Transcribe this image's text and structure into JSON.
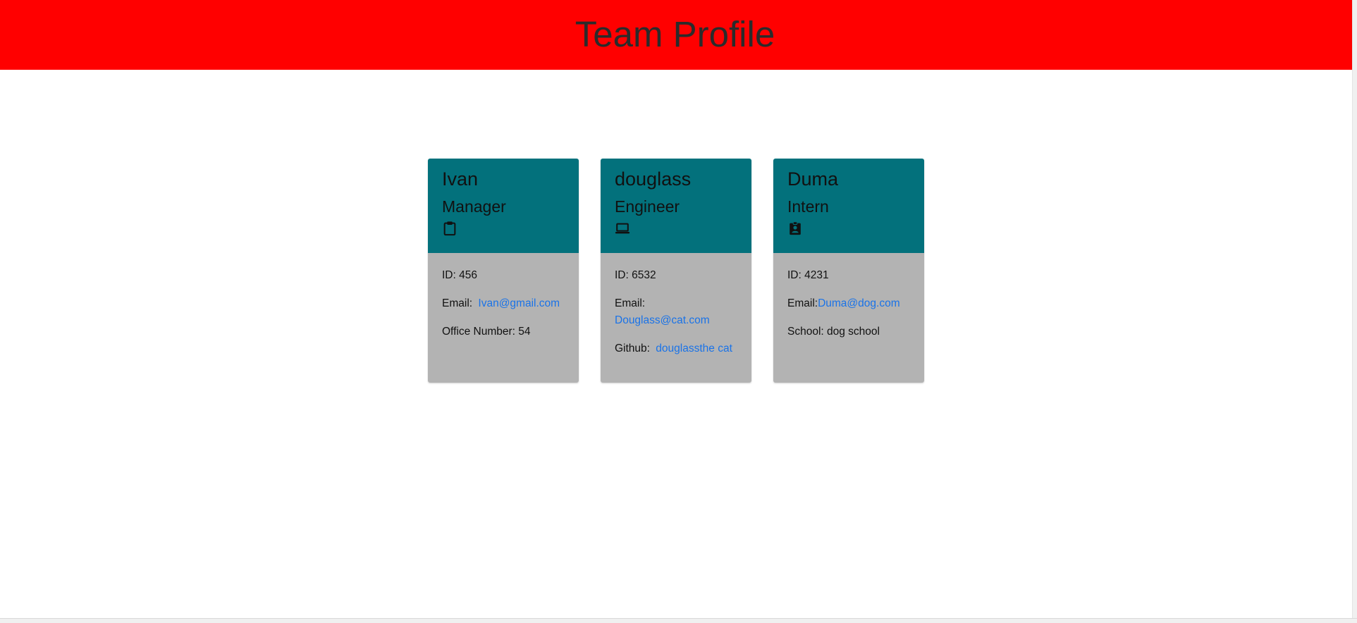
{
  "page": {
    "title": "Team Profile"
  },
  "colors": {
    "banner_bg": "#ff0000",
    "card_header_bg": "#03717c",
    "card_body_bg": "#b3b3b3",
    "link": "#1a73e8"
  },
  "cards": [
    {
      "name": "Ivan",
      "role": "Manager",
      "icon": "clipboard-icon",
      "id_text": "ID: 456",
      "email_label": "Email:",
      "email": "Ivan@gmail.com",
      "extra_label": "Office Number: 54",
      "extra_link": ""
    },
    {
      "name": "douglass",
      "role": "Engineer",
      "icon": "laptop-icon",
      "id_text": "ID: 6532",
      "email_label": "Email:",
      "email": "Douglass@cat.com",
      "extra_label": "Github:",
      "extra_link": "douglassthe cat"
    },
    {
      "name": "Duma",
      "role": "Intern",
      "icon": "student-badge-icon",
      "id_text": "ID: 4231",
      "email_label": "Email:",
      "email": "Duma@dog.com",
      "extra_label": "School: dog school",
      "extra_link": ""
    }
  ]
}
